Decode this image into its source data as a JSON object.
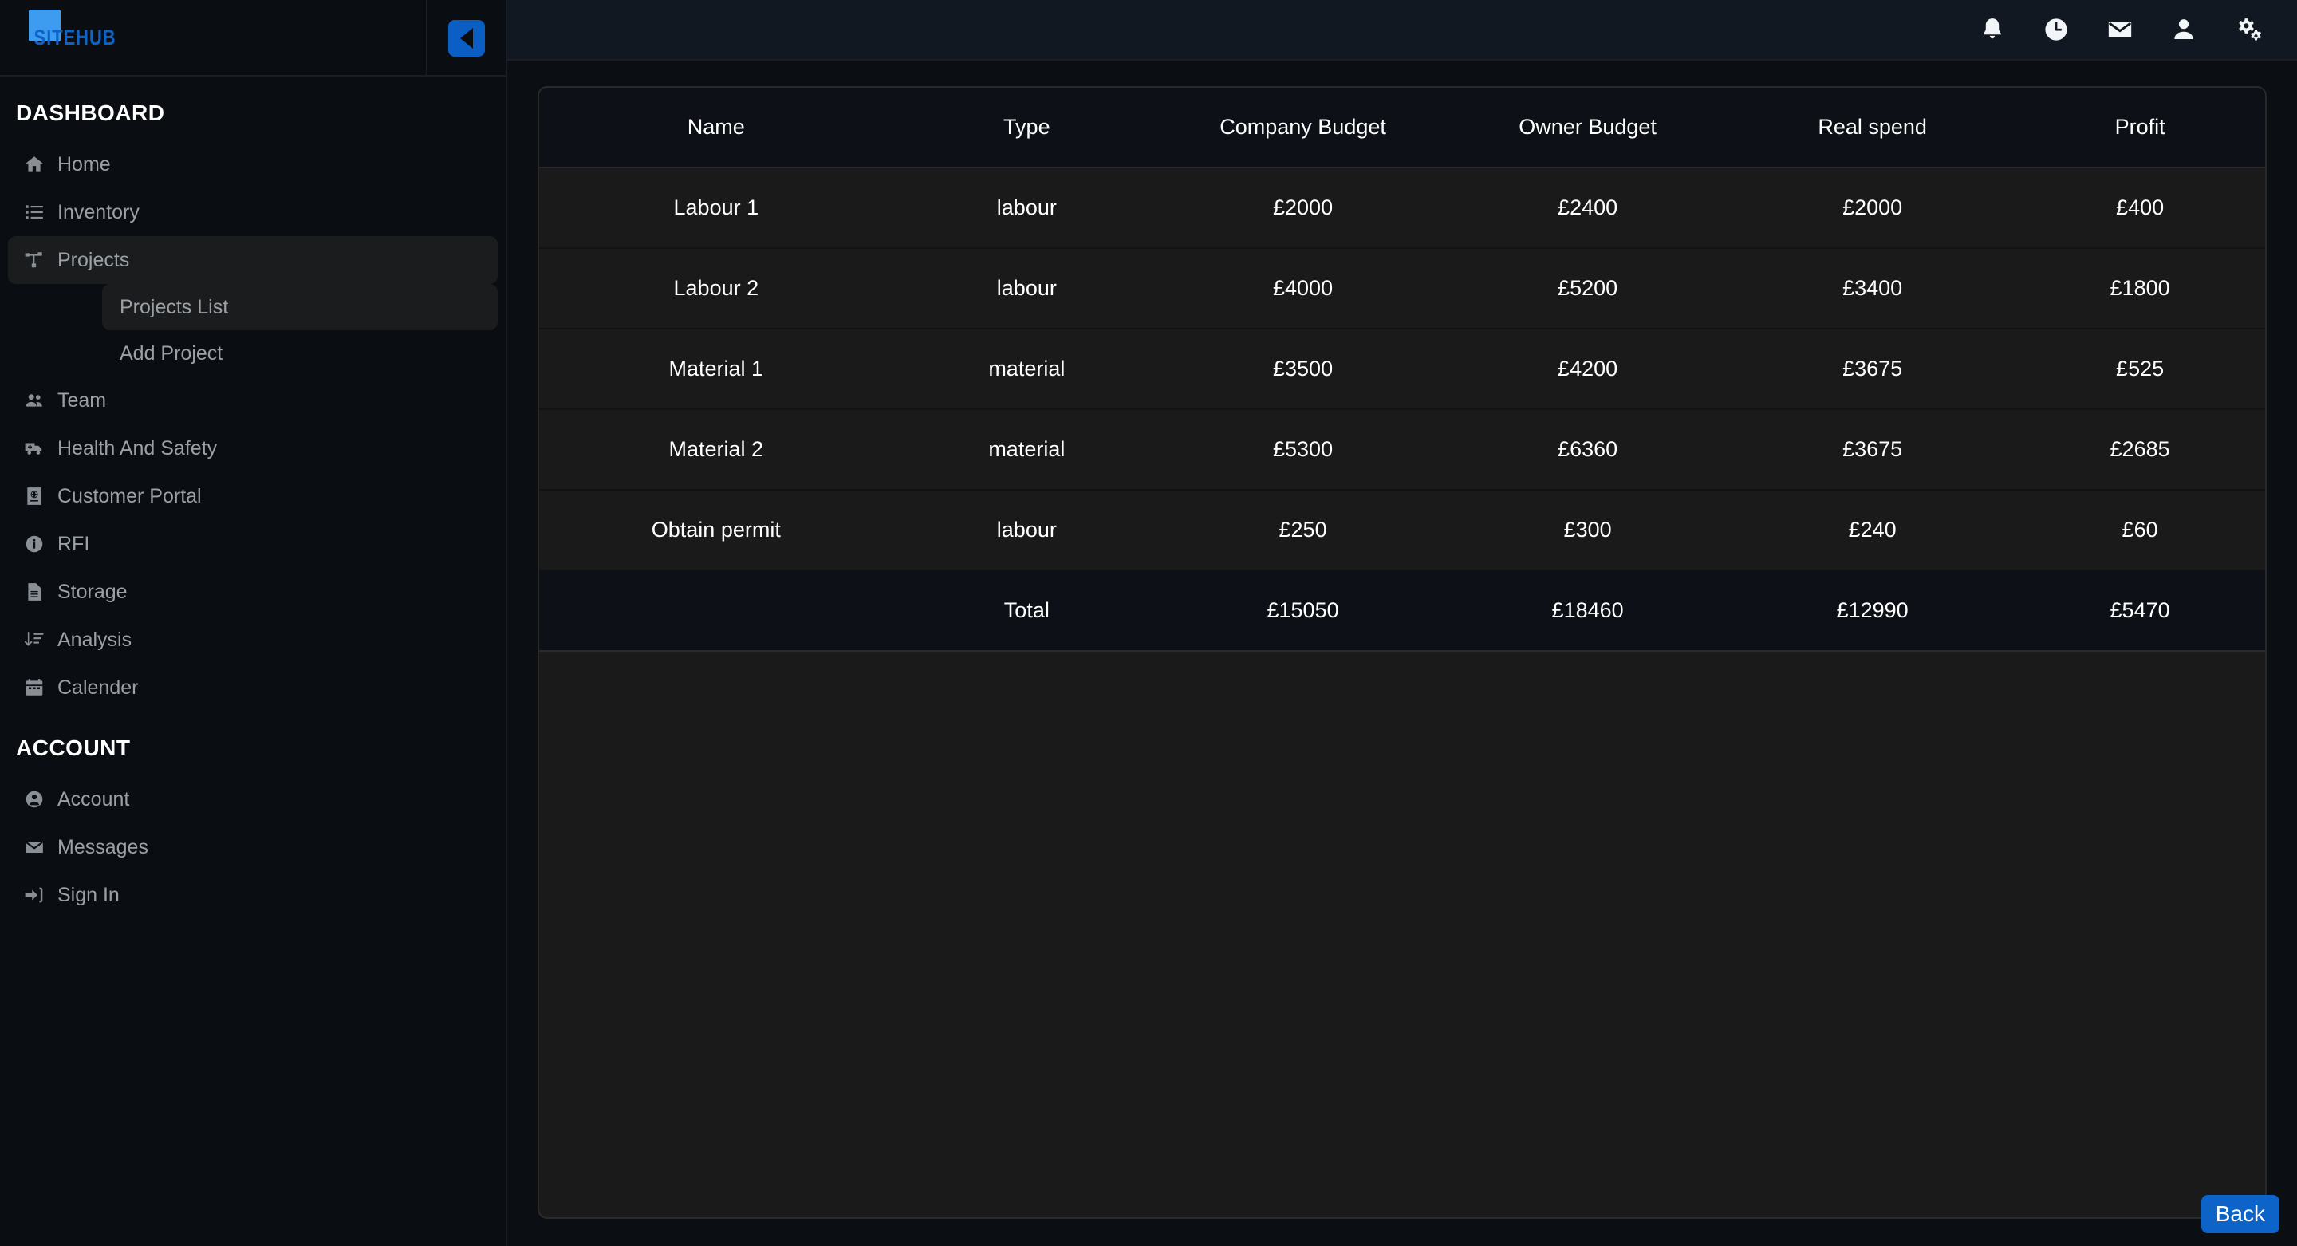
{
  "brand": {
    "name": "SITEHUB",
    "square_color": "#3d9bf0",
    "text_color": "#0d63c8"
  },
  "sidebar": {
    "collapse_icon": "chevron-left-icon",
    "sections": [
      {
        "title": "DASHBOARD",
        "items": [
          {
            "label": "Home",
            "icon": "home-icon",
            "active": false
          },
          {
            "label": "Inventory",
            "icon": "list-icon",
            "active": false
          },
          {
            "label": "Projects",
            "icon": "project-diagram-icon",
            "active": true,
            "children": [
              {
                "label": "Projects List",
                "active": true
              },
              {
                "label": "Add Project",
                "active": false
              }
            ]
          },
          {
            "label": "Team",
            "icon": "users-icon",
            "active": false
          },
          {
            "label": "Health And Safety",
            "icon": "ambulance-icon",
            "active": false
          },
          {
            "label": "Customer Portal",
            "icon": "passport-globe-icon",
            "active": false
          },
          {
            "label": "RFI",
            "icon": "info-circle-icon",
            "active": false
          },
          {
            "label": "Storage",
            "icon": "file-document-icon",
            "active": false
          },
          {
            "label": "Analysis",
            "icon": "sort-amount-down-icon",
            "active": false
          },
          {
            "label": "Calender",
            "icon": "calendar-icon",
            "active": false
          }
        ]
      },
      {
        "title": "ACCOUNT",
        "items": [
          {
            "label": "Account",
            "icon": "user-circle-icon",
            "active": false
          },
          {
            "label": "Messages",
            "icon": "envelope-icon",
            "active": false
          },
          {
            "label": "Sign In",
            "icon": "sign-in-icon",
            "active": false
          }
        ]
      }
    ]
  },
  "topbar": {
    "icons": [
      {
        "name": "bell-icon",
        "label": "Notifications"
      },
      {
        "name": "clock-icon",
        "label": "History"
      },
      {
        "name": "envelope-icon",
        "label": "Messages"
      },
      {
        "name": "user-icon",
        "label": "Profile"
      },
      {
        "name": "cogs-icon",
        "label": "Settings"
      }
    ]
  },
  "table": {
    "columns": [
      "Name",
      "Type",
      "Company Budget",
      "Owner Budget",
      "Real spend",
      "Profit"
    ],
    "rows": [
      {
        "name": "Labour 1",
        "type": "labour",
        "company_budget": "£2000",
        "owner_budget": "£2400",
        "real_spend": "£2000",
        "profit": "£400"
      },
      {
        "name": "Labour 2",
        "type": "labour",
        "company_budget": "£4000",
        "owner_budget": "£5200",
        "real_spend": "£3400",
        "profit": "£1800"
      },
      {
        "name": "Material 1",
        "type": "material",
        "company_budget": "£3500",
        "owner_budget": "£4200",
        "real_spend": "£3675",
        "profit": "£525"
      },
      {
        "name": "Material 2",
        "type": "material",
        "company_budget": "£5300",
        "owner_budget": "£6360",
        "real_spend": "£3675",
        "profit": "£2685"
      },
      {
        "name": "Obtain permit",
        "type": "labour",
        "company_budget": "£250",
        "owner_budget": "£300",
        "real_spend": "£240",
        "profit": "£60"
      }
    ],
    "total": {
      "name": "",
      "type": "Total",
      "company_budget": "£15050",
      "owner_budget": "£18460",
      "real_spend": "£12990",
      "profit": "£5470"
    }
  },
  "footer": {
    "back_label": "Back",
    "back_color": "#0d63c8"
  }
}
